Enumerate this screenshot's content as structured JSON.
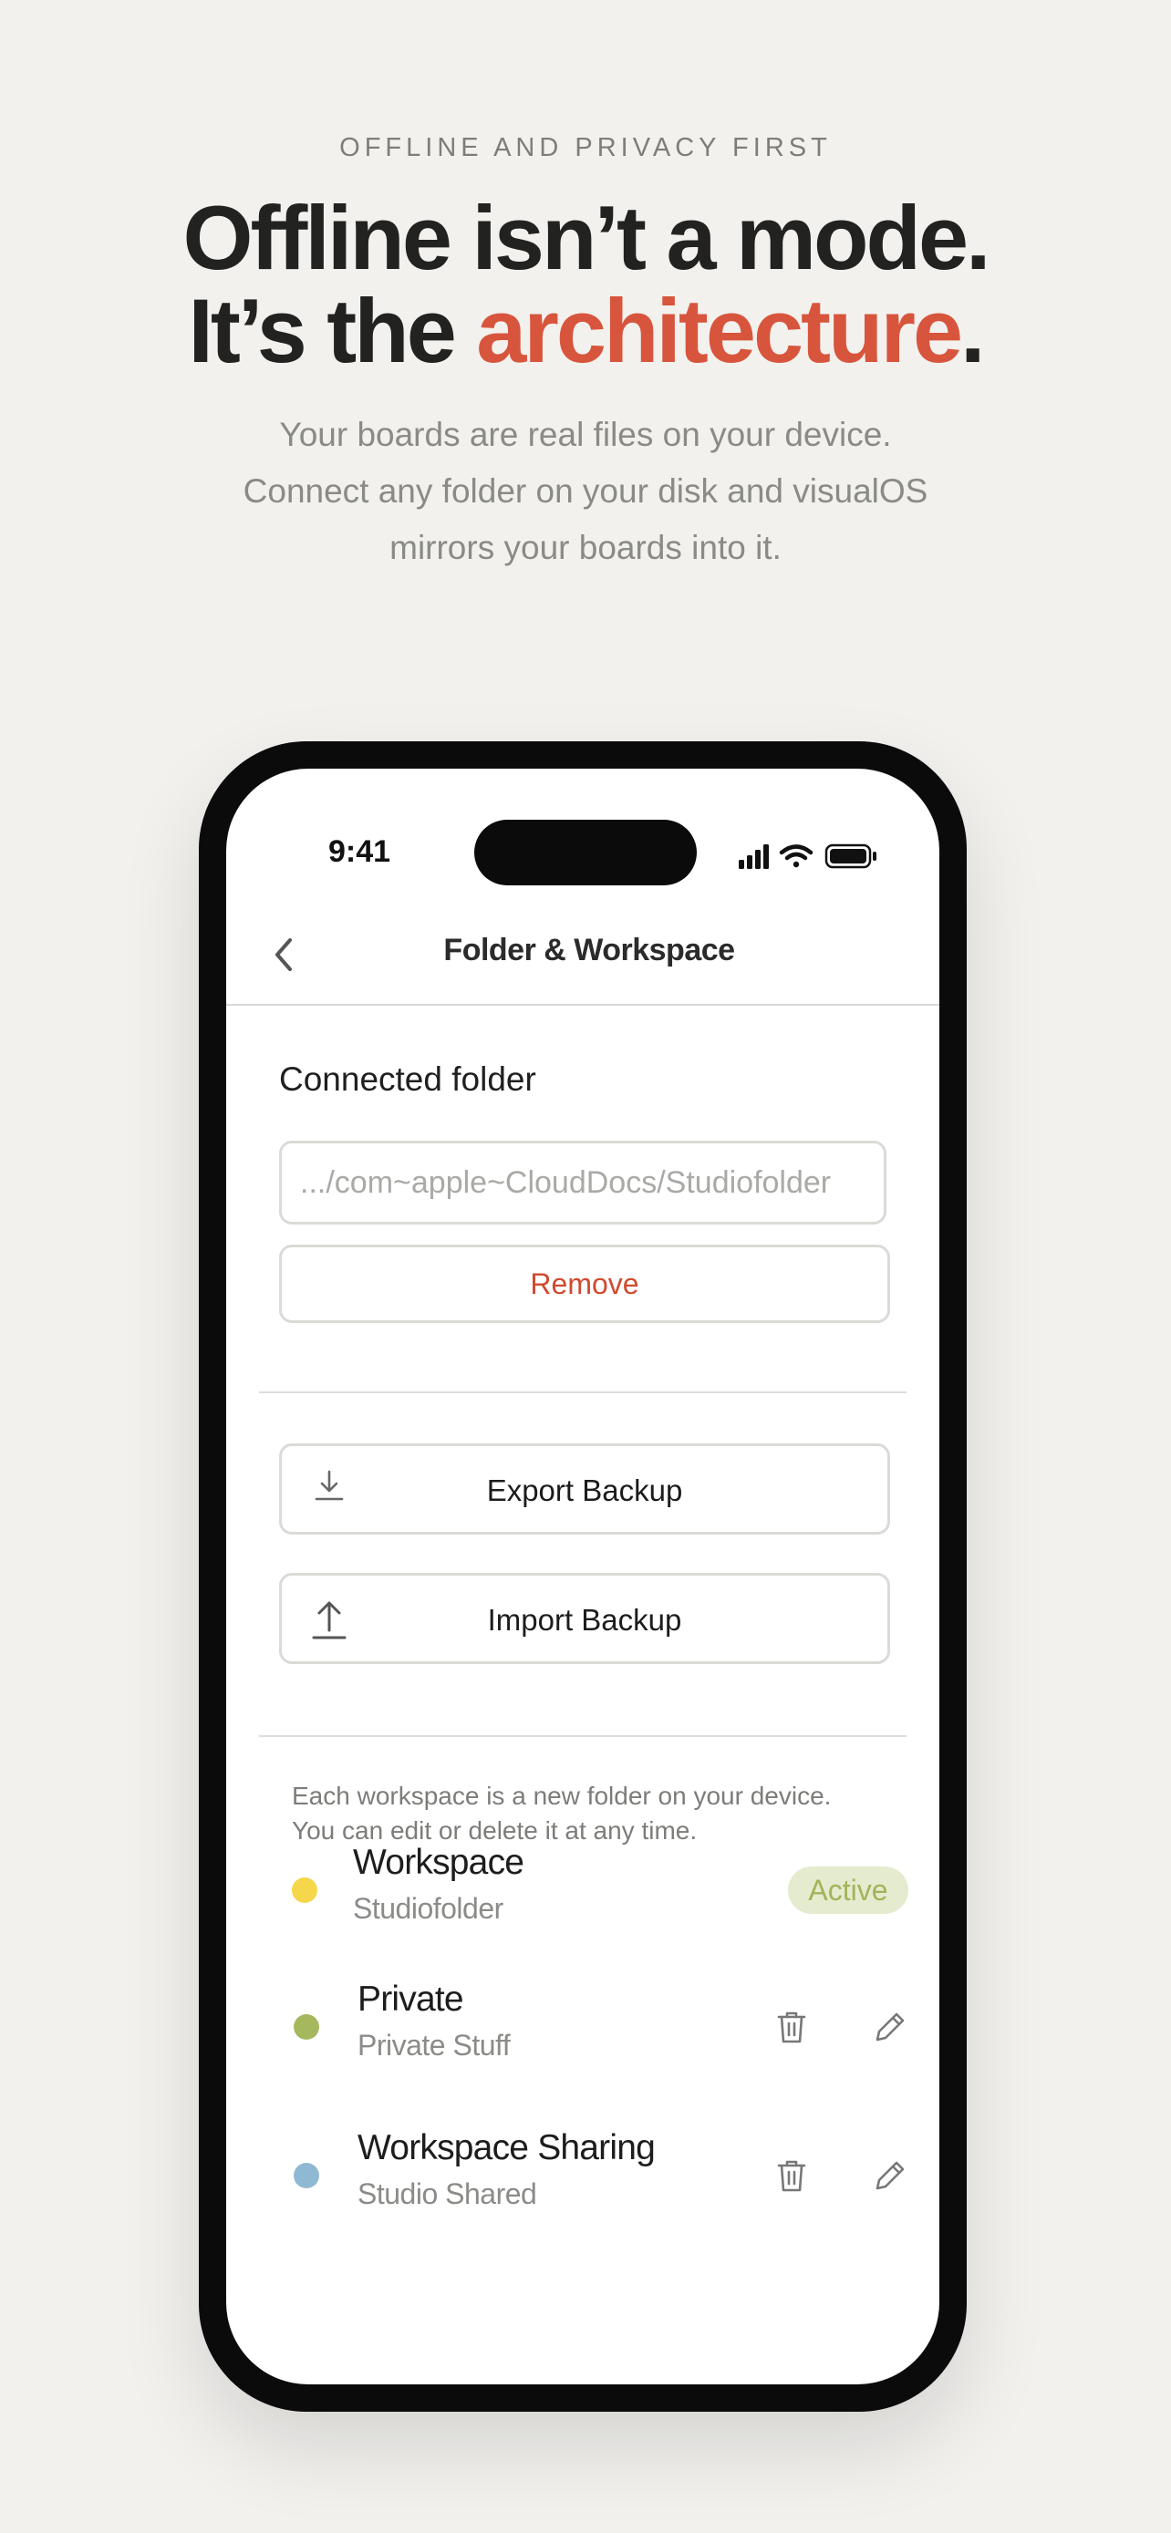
{
  "hero": {
    "eyebrow": "OFFLINE AND PRIVACY FIRST",
    "headline_line1": "Offline isn’t a mode.",
    "headline_line2_prefix": "It’s the ",
    "headline_accent": "architecture",
    "headline_suffix": ".",
    "subtitle_lines": [
      "Your boards are real files on your device.",
      "Connect any folder on your disk and visualOS",
      "mirrors your boards into it."
    ]
  },
  "status_bar": {
    "time": "9:41"
  },
  "nav": {
    "title": "Folder & Workspace"
  },
  "connected_folder": {
    "title": "Connected folder",
    "path_placeholder": ".../com~apple~CloudDocs/Studiofolder",
    "remove_label": "Remove"
  },
  "backup": {
    "export_label": "Export Backup",
    "import_label": "Import Backup"
  },
  "workspaces": {
    "helper_lines": [
      "Each workspace is a new folder on your device.",
      "You can edit or delete it at any time."
    ],
    "active_label": "Active",
    "items": [
      {
        "name": "Workspace",
        "folder": "Studiofolder",
        "color": "#f6d64a"
      },
      {
        "name": "Private",
        "folder": "Private Stuff",
        "color": "#a6b85e"
      },
      {
        "name": "Workspace Sharing",
        "folder": "Studio Shared",
        "color": "#8fb9d3"
      }
    ]
  },
  "colors": {
    "accent": "#d8553d",
    "remove": "#cf4a30",
    "active_badge_bg": "#e4ebce",
    "active_badge_text": "#a3b35a"
  }
}
